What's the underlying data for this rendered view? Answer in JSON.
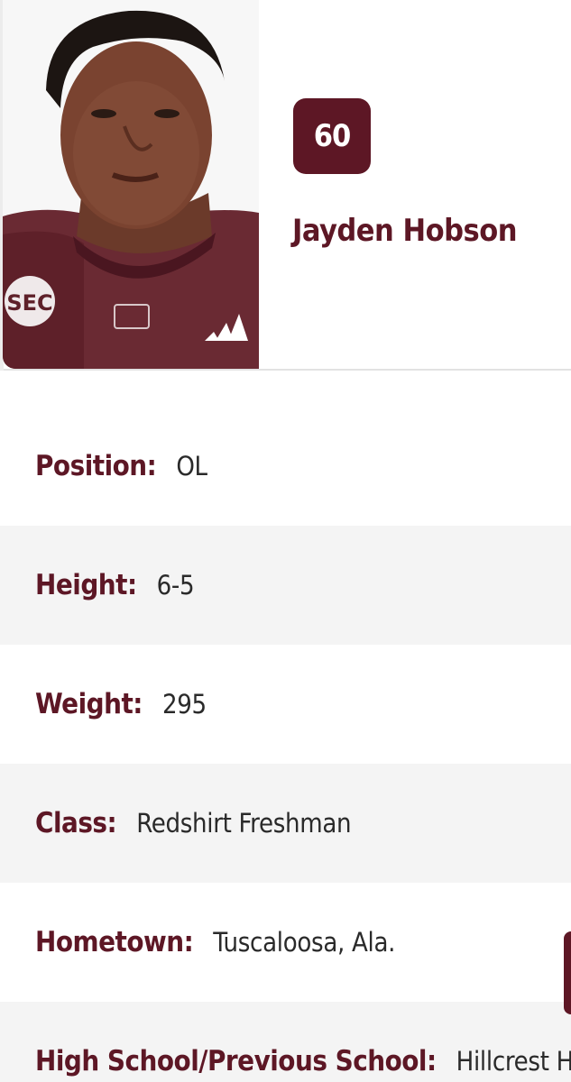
{
  "player": {
    "jersey_number": "60",
    "name": "Jayden Hobson",
    "photo_icon": "player-headshot"
  },
  "bio": [
    {
      "label": "Position:",
      "value": "OL"
    },
    {
      "label": "Height:",
      "value": "6-5"
    },
    {
      "label": "Weight:",
      "value": "295"
    },
    {
      "label": "Class:",
      "value": "Redshirt Freshman"
    },
    {
      "label": "Hometown:",
      "value": "Tuscaloosa, Ala."
    },
    {
      "label": "High School/Previous School:",
      "value": "Hillcrest HS"
    }
  ],
  "photo_logo_text": "SEC",
  "colors": {
    "maroon": "#5d1725",
    "row_alt": "#f4f4f4",
    "text": "#2a2a2a"
  }
}
